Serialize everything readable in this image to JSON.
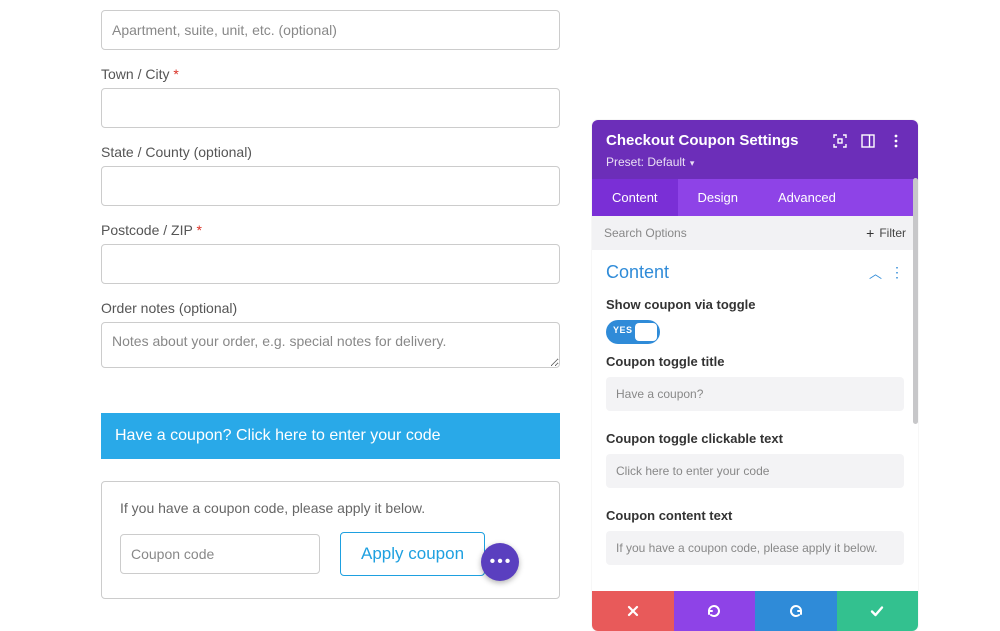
{
  "billing": {
    "apartment_placeholder": "Apartment, suite, unit, etc. (optional)",
    "town_label": "Town / City",
    "state_label": "State / County (optional)",
    "postcode_label": "Postcode / ZIP",
    "order_notes_label": "Order notes (optional)",
    "order_notes_placeholder": "Notes about your order, e.g. special notes for delivery."
  },
  "coupon": {
    "bar_text": "Have a coupon? Click here to enter your code",
    "box_text": "If you have a coupon code, please apply it below.",
    "code_placeholder": "Coupon code",
    "apply_label": "Apply coupon"
  },
  "panel": {
    "title": "Checkout Coupon Settings",
    "preset_label": "Preset: Default",
    "tabs": {
      "content": "Content",
      "design": "Design",
      "advanced": "Advanced"
    },
    "search_placeholder": "Search Options",
    "filter_label": "Filter",
    "section_title": "Content",
    "opts": {
      "show_toggle_label": "Show coupon via toggle",
      "toggle_value": "YES",
      "toggle_title_label": "Coupon toggle title",
      "toggle_title_placeholder": "Have a coupon?",
      "clickable_label": "Coupon toggle clickable text",
      "clickable_placeholder": "Click here to enter your code",
      "content_text_label": "Coupon content text",
      "content_text_placeholder": "If you have a coupon code, please apply it below."
    }
  }
}
